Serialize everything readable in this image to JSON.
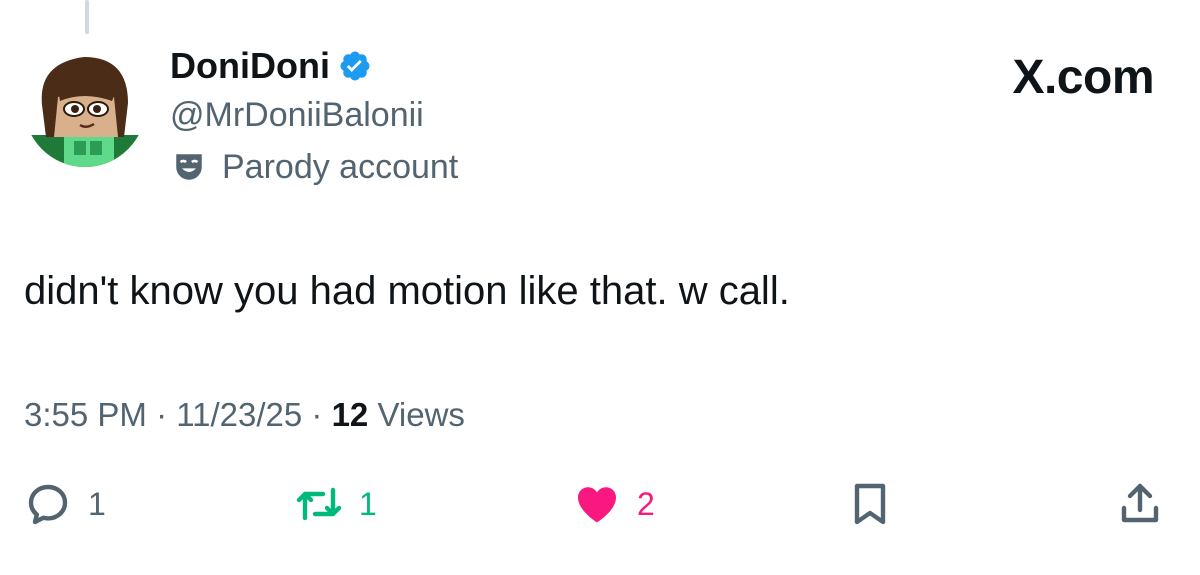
{
  "author": {
    "display_name": "DoniDoni",
    "handle": "@MrDoniiBalonii",
    "verified": true,
    "label": "Parody account"
  },
  "brand": "X.com",
  "tweet": {
    "text": "didn't know you had motion like that. w call."
  },
  "meta": {
    "time": "3:55 PM",
    "sep": " · ",
    "date": "11/23/25",
    "views_count": "12",
    "views_label": " Views"
  },
  "actions": {
    "reply_count": "1",
    "repost_count": "1",
    "like_count": "2",
    "like_active": true
  },
  "colors": {
    "verified": "#1d9bf0",
    "repost": "#00ba7c",
    "like": "#f91880",
    "secondary_text": "#536471",
    "primary_text": "#0f1419"
  },
  "icons": [
    "verified-badge-icon",
    "parody-mask-icon",
    "reply-icon",
    "repost-icon",
    "heart-icon",
    "bookmark-icon",
    "share-icon"
  ]
}
